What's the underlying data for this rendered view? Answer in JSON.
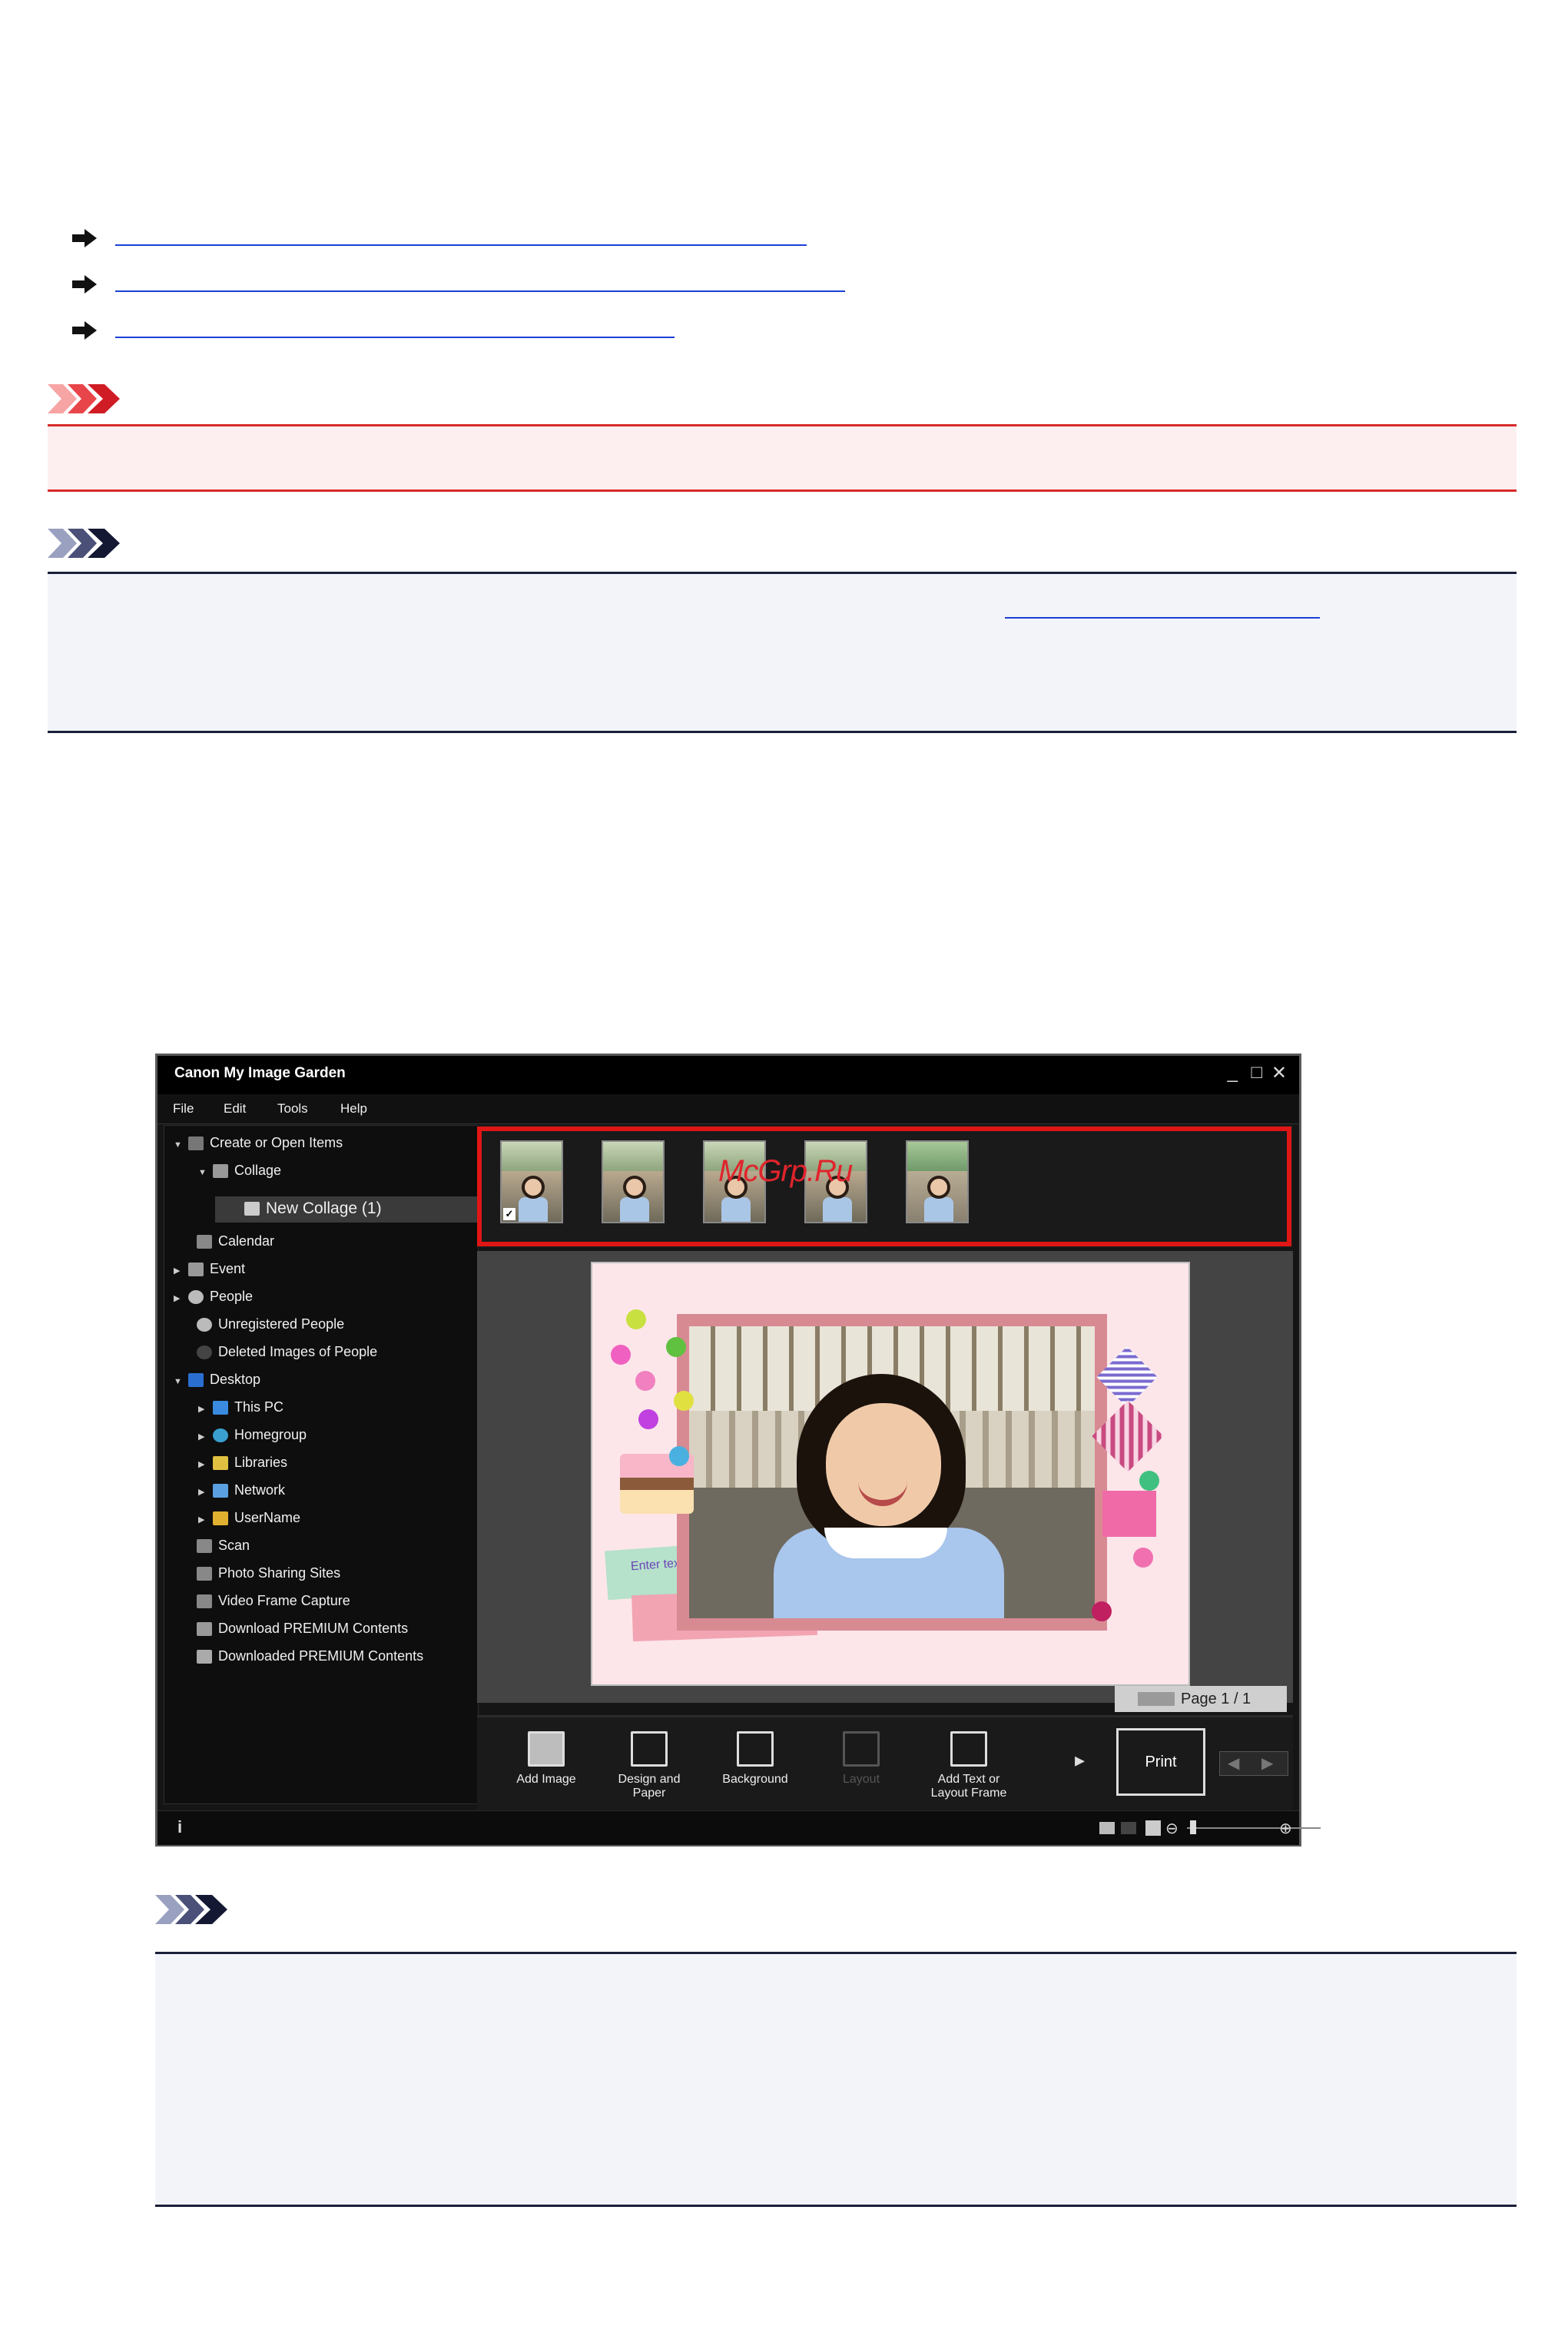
{
  "links": [
    "",
    "",
    ""
  ],
  "app": {
    "title": "Canon My Image Garden",
    "window_controls": [
      "_",
      "□",
      "✕"
    ],
    "menu": [
      "File",
      "Edit",
      "Tools",
      "Help"
    ],
    "tree": [
      {
        "label": "Create or Open Items",
        "level": 0,
        "expanded": true
      },
      {
        "label": "Collage",
        "level": 1,
        "expanded": true
      },
      {
        "label": "New Collage (1)",
        "level": 2,
        "selected": true
      },
      {
        "label": "Calendar",
        "level": 0
      },
      {
        "label": "Event",
        "level": 0,
        "collapsed": true
      },
      {
        "label": "People",
        "level": 0,
        "collapsed": true
      },
      {
        "label": "Unregistered People",
        "level": 0
      },
      {
        "label": "Deleted Images of People",
        "level": 0
      },
      {
        "label": "Desktop",
        "level": 0,
        "expanded": true
      },
      {
        "label": "This PC",
        "level": 1,
        "collapsed": true
      },
      {
        "label": "Homegroup",
        "level": 1,
        "collapsed": true
      },
      {
        "label": "Libraries",
        "level": 1,
        "collapsed": true
      },
      {
        "label": "Network",
        "level": 1,
        "collapsed": true
      },
      {
        "label": "UserName",
        "level": 1,
        "collapsed": true
      },
      {
        "label": "Scan",
        "level": 0
      },
      {
        "label": "Photo Sharing Sites",
        "level": 0
      },
      {
        "label": "Video Frame Capture",
        "level": 0
      },
      {
        "label": "Download PREMIUM Contents",
        "level": 0
      },
      {
        "label": "Downloaded PREMIUM Contents",
        "level": 0
      }
    ],
    "watermark": "McGrp.Ru",
    "enter_text": "Enter text",
    "page_label": "Page 1 / 1",
    "toolbar": {
      "add_image": "Add Image",
      "design_and_paper": "Design and\nPaper",
      "background": "Background",
      "layout": "Layout",
      "add_text": "Add Text or\nLayout Frame",
      "print": "Print"
    },
    "status_info": "i"
  },
  "colors": {
    "important_red": "#d82a2a",
    "note_navy": "#1a1f3a",
    "link_blue": "#1a3fd6",
    "highlight_red": "#e01616"
  }
}
